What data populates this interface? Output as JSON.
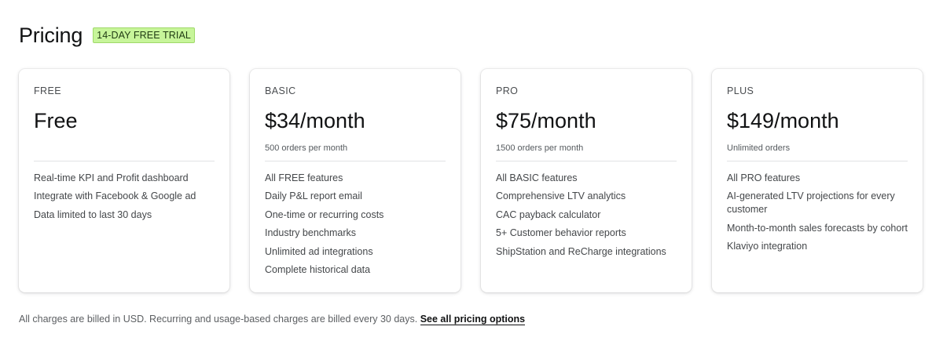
{
  "header": {
    "title": "Pricing",
    "trial_badge": "14-DAY FREE TRIAL"
  },
  "plans": [
    {
      "name": "FREE",
      "price": "Free",
      "subtitle": "",
      "features": [
        "Real-time KPI and Profit dashboard",
        "Integrate with Facebook & Google ad",
        "Data limited to last 30 days"
      ]
    },
    {
      "name": "BASIC",
      "price": "$34/month",
      "subtitle": "500 orders per month",
      "features": [
        "All FREE features",
        "Daily P&L report email",
        "One-time or recurring costs",
        "Industry benchmarks",
        "Unlimited ad integrations",
        "Complete historical data"
      ]
    },
    {
      "name": "PRO",
      "price": "$75/month",
      "subtitle": "1500 orders per month",
      "features": [
        "All BASIC features",
        "Comprehensive LTV analytics",
        "CAC payback calculator",
        "5+ Customer behavior reports",
        "ShipStation and ReCharge integrations"
      ]
    },
    {
      "name": "PLUS",
      "price": "$149/month",
      "subtitle": "Unlimited orders",
      "features": [
        "All PRO features",
        "AI-generated LTV projections for every customer",
        "Month-to-month sales forecasts by cohort",
        "Klaviyo integration"
      ]
    }
  ],
  "footer": {
    "text": "All charges are billed in USD. Recurring and usage-based charges are billed every 30 days.",
    "link_label": "See all pricing options"
  },
  "colors": {
    "badge_background": "#c7f59a",
    "badge_border": "#9fd96a",
    "card_background": "#ffffff",
    "divider": "#e1e3e5"
  }
}
